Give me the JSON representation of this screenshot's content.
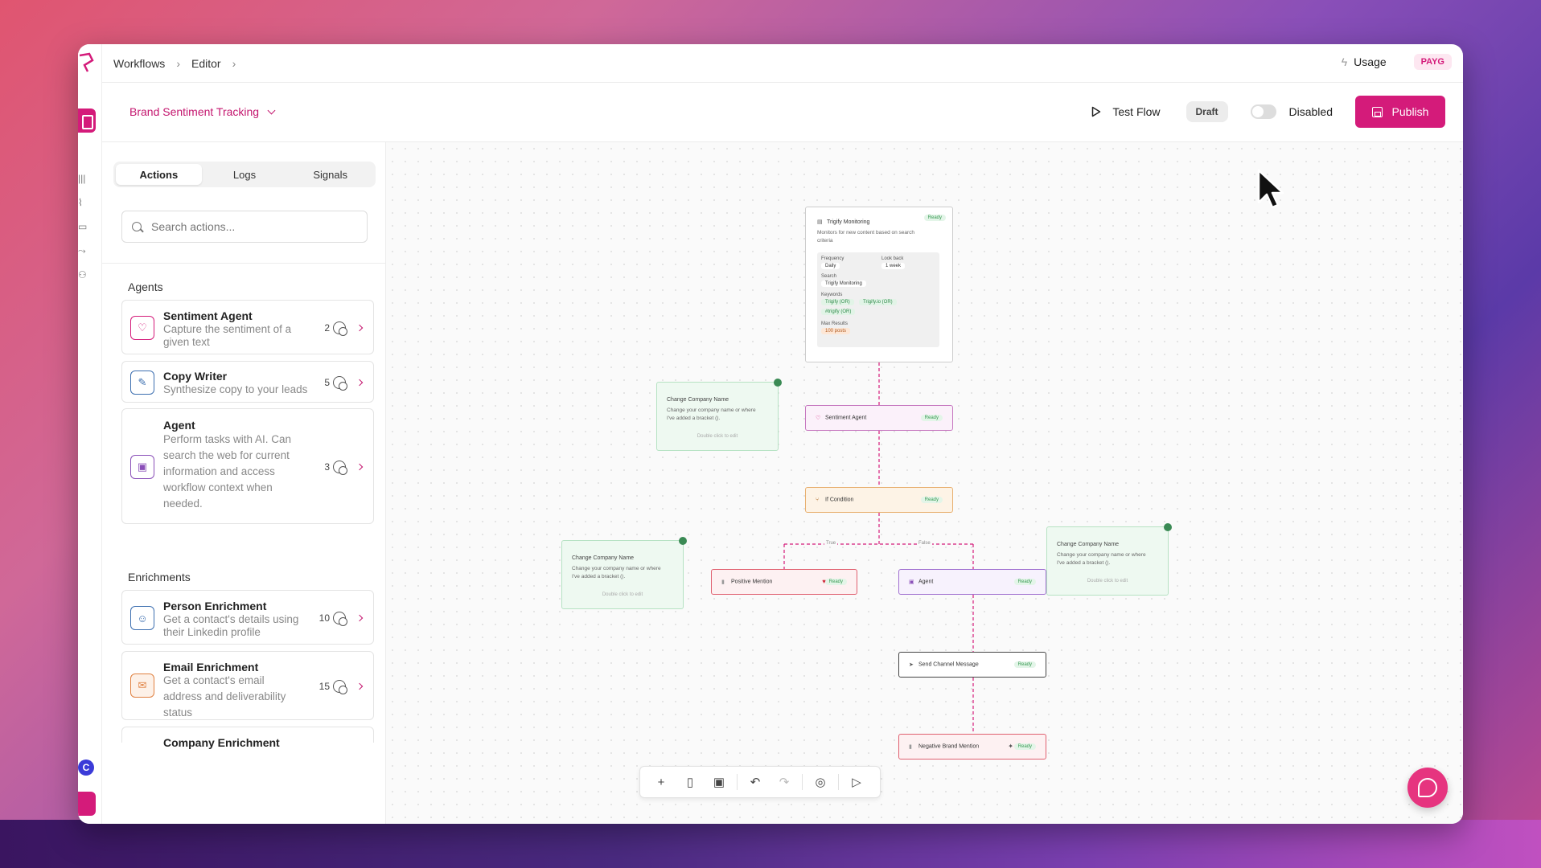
{
  "breadcrumb": {
    "items": [
      "Workflows",
      "Editor"
    ]
  },
  "topbar": {
    "usage_label": "Usage",
    "plan_badge": "PAYG"
  },
  "workflow": {
    "name": "Brand Sentiment Tracking",
    "test_flow_label": "Test Flow",
    "status_badge": "Draft",
    "toggle_label": "Disabled",
    "publish_label": "Publish"
  },
  "panel": {
    "tabs": [
      "Actions",
      "Logs",
      "Signals"
    ],
    "active_tab": "Actions",
    "search_placeholder": "Search actions...",
    "sections": {
      "agents": "Agents",
      "enrichments": "Enrichments"
    },
    "agents": [
      {
        "title": "Sentiment Agent",
        "desc1": "Capture the sentiment of a",
        "desc2": "given text",
        "count": "2"
      },
      {
        "title": "Copy Writer",
        "desc1": "Synthesize copy to your leads",
        "count": "5"
      },
      {
        "title": "Agent",
        "desc1": "Perform tasks with AI. Can",
        "desc2": "search the web for current",
        "desc3": "information and access",
        "desc4": "workflow context when",
        "desc5": "needed.",
        "count": "3"
      }
    ],
    "enrichments": [
      {
        "title": "Person Enrichment",
        "desc1": "Get a contact's details using",
        "desc2": "their Linkedin profile",
        "count": "10"
      },
      {
        "title": "Email Enrichment",
        "desc1": "Get a contact's email",
        "desc2": "address and deliverability",
        "desc3": "status",
        "count": "15"
      },
      {
        "title": "Company Enrichment"
      }
    ]
  },
  "canvas": {
    "trigger": {
      "title": "Trigify Monitoring",
      "status": "Ready",
      "desc1": "Monitors for new content based on search",
      "desc2": "criteria",
      "frequency_label": "Frequency",
      "frequency_value": "Daily",
      "lookback_label": "Look back",
      "lookback_value": "1 week",
      "search_label": "Search",
      "search_value": "Trigify Monitoring",
      "keywords_label": "Keywords",
      "keywords": [
        "Trigify (OR)",
        "Trigify.io (OR)",
        "#trigify (OR)"
      ],
      "max_results_label": "Max Results",
      "max_results_value": "100 posts"
    },
    "nodes": {
      "sentiment": {
        "title": "Sentiment Agent",
        "status": "Ready"
      },
      "if": {
        "title": "If Condition",
        "status": "Ready"
      },
      "positive": {
        "title": "Positive Mention",
        "status": "Ready"
      },
      "agent": {
        "title": "Agent",
        "status": "Ready"
      },
      "send": {
        "title": "Send Channel Message",
        "status": "Ready"
      },
      "negative": {
        "title": "Negative Brand Mention",
        "status": "Ready"
      }
    },
    "edge_labels": {
      "true": "True",
      "false": "False"
    },
    "note": {
      "title": "Change Company Name",
      "text1": "Change your company name or where",
      "text2": "I've added a bracket ().",
      "hint": "Double click to edit"
    }
  },
  "colors": {
    "accent": "#d41b7a",
    "ready": "#3a9a54"
  }
}
